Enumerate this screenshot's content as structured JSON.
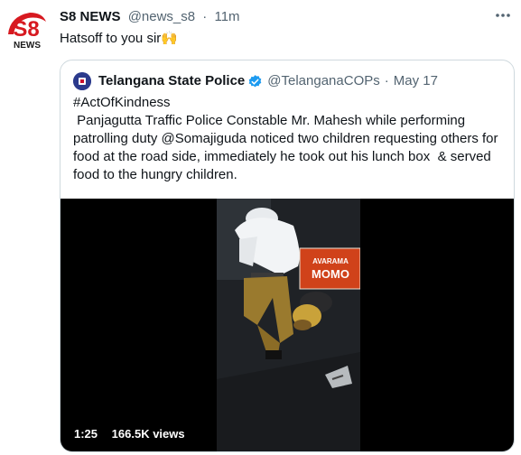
{
  "tweet": {
    "author_avatar_text": "S8",
    "author_avatar_sub": "NEWS",
    "author_name": "S8 NEWS",
    "author_handle": "@news_s8",
    "separator": "·",
    "time": "11m",
    "text": "Hatsoff to you sir",
    "emoji": "🙌",
    "more_icon": "more-icon"
  },
  "quoted": {
    "author_name": "Telangana State Police",
    "verified_icon": "verified-badge-icon",
    "author_handle": "@TelanganaCOPs",
    "separator": "·",
    "date": "May 17",
    "hashtag": "#ActOfKindness",
    "body": " Panjagutta Traffic Police Constable Mr. Mahesh while performing patrolling duty @Somajiguda noticed two children requesting others for food at the road side, immediately he took out his lunch box  & served food to the hungry children.",
    "video": {
      "duration": "1:25",
      "views": "166.5K views",
      "banner_text_1": "AVARAMA",
      "banner_text_2": "MOMO"
    }
  },
  "colors": {
    "text": "#0f1419",
    "secondary": "#536471",
    "border": "#cfd9de",
    "verified": "#1d9bf0",
    "brand_red": "#d71920"
  }
}
